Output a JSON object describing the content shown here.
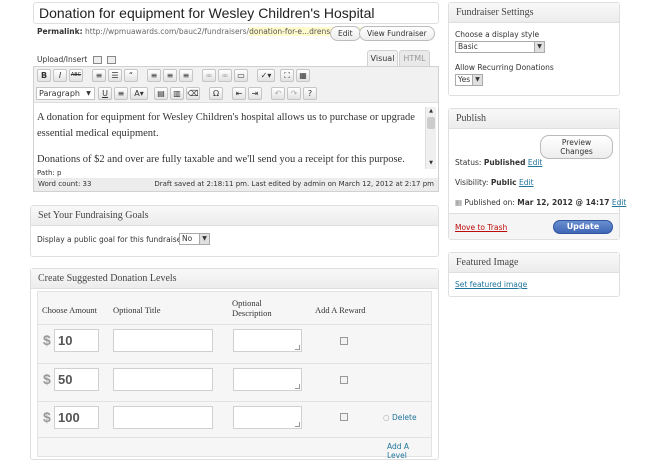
{
  "post": {
    "title": "Donation for equipment for Wesley Children's Hospital",
    "permalink_label": "Permalink:",
    "permalink_base": "http://wpmuawards.com/bauc2/fundraisers/",
    "permalink_slug": "donation-for-e...drens-hospital",
    "permalink_tail": "/",
    "edit_label": "Edit",
    "view_label": "View Fundraiser"
  },
  "editor": {
    "upload_label": "Upload/Insert",
    "tab_visual": "Visual",
    "tab_html": "HTML",
    "format_select": "Paragraph",
    "content_p1": "A donation for equipment for Wesley Children's hospital allows us to purchase or upgrade essential medical equipment.",
    "content_p2": "Donations of $2 and over are fully taxable and we'll send you a receipt for this purpose.",
    "path_label": "Path: p",
    "word_count": "Word count: 33",
    "draft_status": "Draft saved at 2:18:11 pm. Last edited by admin on March 12, 2012 at 2:17 pm",
    "toolbar_row1": [
      "B",
      "I",
      "ABC",
      "list-ul",
      "list-ol",
      "quote",
      "align-left",
      "align-center",
      "align-right",
      "link",
      "unlink",
      "more",
      "spell",
      "fullscreen",
      "kitchen-sink"
    ],
    "toolbar_row2": [
      "underline",
      "justify",
      "text-color",
      "paste-text",
      "paste-word",
      "remove-format",
      "special-char",
      "outdent",
      "indent",
      "undo",
      "redo",
      "help"
    ]
  },
  "goals": {
    "title": "Set Your Fundraising Goals",
    "label": "Display a public goal for this fundraiser?",
    "value": "No"
  },
  "levels": {
    "title": "Create Suggested Donation Levels",
    "col_amount": "Choose Amount",
    "col_title": "Optional Title",
    "col_desc": "Optional Description",
    "col_reward": "Add A Reward",
    "currency": "$",
    "rows": [
      {
        "amount": "10",
        "delete": ""
      },
      {
        "amount": "50",
        "delete": ""
      },
      {
        "amount": "100",
        "delete": "Delete"
      }
    ],
    "add_level": "Add A Level"
  },
  "settings": {
    "title": "Fundraiser Settings",
    "style_label": "Choose a display style",
    "style_value": "Basic",
    "recurring_label": "Allow Recurring Donations",
    "recurring_value": "Yes"
  },
  "publish": {
    "title": "Publish",
    "preview_label": "Preview Changes",
    "status_label": "Status:",
    "status_value": "Published",
    "status_edit": "Edit",
    "visibility_label": "Visibility:",
    "visibility_value": "Public",
    "visibility_edit": "Edit",
    "published_label": "Published on:",
    "published_value": "Mar 12, 2012 @ 14:17",
    "published_edit": "Edit",
    "trash_label": "Move to Trash",
    "update_label": "Update"
  },
  "featured": {
    "title": "Featured Image",
    "link": "Set featured image"
  },
  "colors": {
    "link": "#21759b",
    "trash": "#bc0b0b",
    "update_button": "#3f66b5",
    "box_border": "#dfdfdf"
  }
}
